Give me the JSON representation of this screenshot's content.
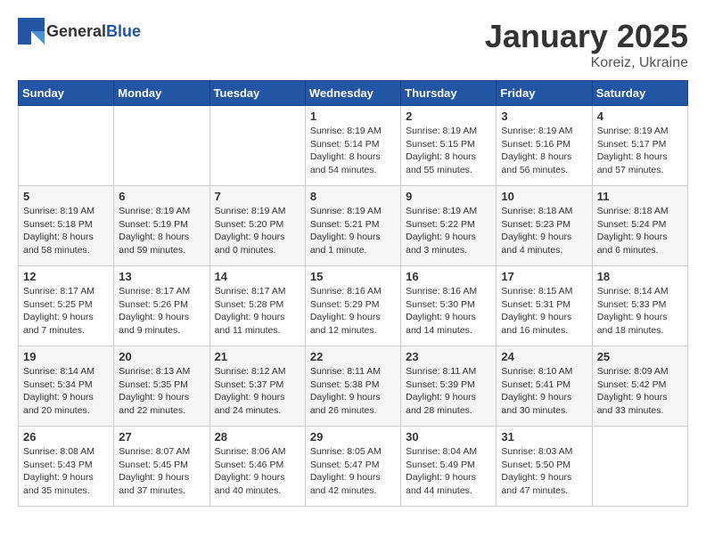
{
  "logo": {
    "text_general": "General",
    "text_blue": "Blue"
  },
  "title": "January 2025",
  "subtitle": "Koreiz, Ukraine",
  "days_of_week": [
    "Sunday",
    "Monday",
    "Tuesday",
    "Wednesday",
    "Thursday",
    "Friday",
    "Saturday"
  ],
  "weeks": [
    [
      {
        "day": "",
        "info": ""
      },
      {
        "day": "",
        "info": ""
      },
      {
        "day": "",
        "info": ""
      },
      {
        "day": "1",
        "info": "Sunrise: 8:19 AM\nSunset: 5:14 PM\nDaylight: 8 hours\nand 54 minutes."
      },
      {
        "day": "2",
        "info": "Sunrise: 8:19 AM\nSunset: 5:15 PM\nDaylight: 8 hours\nand 55 minutes."
      },
      {
        "day": "3",
        "info": "Sunrise: 8:19 AM\nSunset: 5:16 PM\nDaylight: 8 hours\nand 56 minutes."
      },
      {
        "day": "4",
        "info": "Sunrise: 8:19 AM\nSunset: 5:17 PM\nDaylight: 8 hours\nand 57 minutes."
      }
    ],
    [
      {
        "day": "5",
        "info": "Sunrise: 8:19 AM\nSunset: 5:18 PM\nDaylight: 8 hours\nand 58 minutes."
      },
      {
        "day": "6",
        "info": "Sunrise: 8:19 AM\nSunset: 5:19 PM\nDaylight: 8 hours\nand 59 minutes."
      },
      {
        "day": "7",
        "info": "Sunrise: 8:19 AM\nSunset: 5:20 PM\nDaylight: 9 hours\nand 0 minutes."
      },
      {
        "day": "8",
        "info": "Sunrise: 8:19 AM\nSunset: 5:21 PM\nDaylight: 9 hours\nand 1 minute."
      },
      {
        "day": "9",
        "info": "Sunrise: 8:19 AM\nSunset: 5:22 PM\nDaylight: 9 hours\nand 3 minutes."
      },
      {
        "day": "10",
        "info": "Sunrise: 8:18 AM\nSunset: 5:23 PM\nDaylight: 9 hours\nand 4 minutes."
      },
      {
        "day": "11",
        "info": "Sunrise: 8:18 AM\nSunset: 5:24 PM\nDaylight: 9 hours\nand 6 minutes."
      }
    ],
    [
      {
        "day": "12",
        "info": "Sunrise: 8:17 AM\nSunset: 5:25 PM\nDaylight: 9 hours\nand 7 minutes."
      },
      {
        "day": "13",
        "info": "Sunrise: 8:17 AM\nSunset: 5:26 PM\nDaylight: 9 hours\nand 9 minutes."
      },
      {
        "day": "14",
        "info": "Sunrise: 8:17 AM\nSunset: 5:28 PM\nDaylight: 9 hours\nand 11 minutes."
      },
      {
        "day": "15",
        "info": "Sunrise: 8:16 AM\nSunset: 5:29 PM\nDaylight: 9 hours\nand 12 minutes."
      },
      {
        "day": "16",
        "info": "Sunrise: 8:16 AM\nSunset: 5:30 PM\nDaylight: 9 hours\nand 14 minutes."
      },
      {
        "day": "17",
        "info": "Sunrise: 8:15 AM\nSunset: 5:31 PM\nDaylight: 9 hours\nand 16 minutes."
      },
      {
        "day": "18",
        "info": "Sunrise: 8:14 AM\nSunset: 5:33 PM\nDaylight: 9 hours\nand 18 minutes."
      }
    ],
    [
      {
        "day": "19",
        "info": "Sunrise: 8:14 AM\nSunset: 5:34 PM\nDaylight: 9 hours\nand 20 minutes."
      },
      {
        "day": "20",
        "info": "Sunrise: 8:13 AM\nSunset: 5:35 PM\nDaylight: 9 hours\nand 22 minutes."
      },
      {
        "day": "21",
        "info": "Sunrise: 8:12 AM\nSunset: 5:37 PM\nDaylight: 9 hours\nand 24 minutes."
      },
      {
        "day": "22",
        "info": "Sunrise: 8:11 AM\nSunset: 5:38 PM\nDaylight: 9 hours\nand 26 minutes."
      },
      {
        "day": "23",
        "info": "Sunrise: 8:11 AM\nSunset: 5:39 PM\nDaylight: 9 hours\nand 28 minutes."
      },
      {
        "day": "24",
        "info": "Sunrise: 8:10 AM\nSunset: 5:41 PM\nDaylight: 9 hours\nand 30 minutes."
      },
      {
        "day": "25",
        "info": "Sunrise: 8:09 AM\nSunset: 5:42 PM\nDaylight: 9 hours\nand 33 minutes."
      }
    ],
    [
      {
        "day": "26",
        "info": "Sunrise: 8:08 AM\nSunset: 5:43 PM\nDaylight: 9 hours\nand 35 minutes."
      },
      {
        "day": "27",
        "info": "Sunrise: 8:07 AM\nSunset: 5:45 PM\nDaylight: 9 hours\nand 37 minutes."
      },
      {
        "day": "28",
        "info": "Sunrise: 8:06 AM\nSunset: 5:46 PM\nDaylight: 9 hours\nand 40 minutes."
      },
      {
        "day": "29",
        "info": "Sunrise: 8:05 AM\nSunset: 5:47 PM\nDaylight: 9 hours\nand 42 minutes."
      },
      {
        "day": "30",
        "info": "Sunrise: 8:04 AM\nSunset: 5:49 PM\nDaylight: 9 hours\nand 44 minutes."
      },
      {
        "day": "31",
        "info": "Sunrise: 8:03 AM\nSunset: 5:50 PM\nDaylight: 9 hours\nand 47 minutes."
      },
      {
        "day": "",
        "info": ""
      }
    ]
  ]
}
